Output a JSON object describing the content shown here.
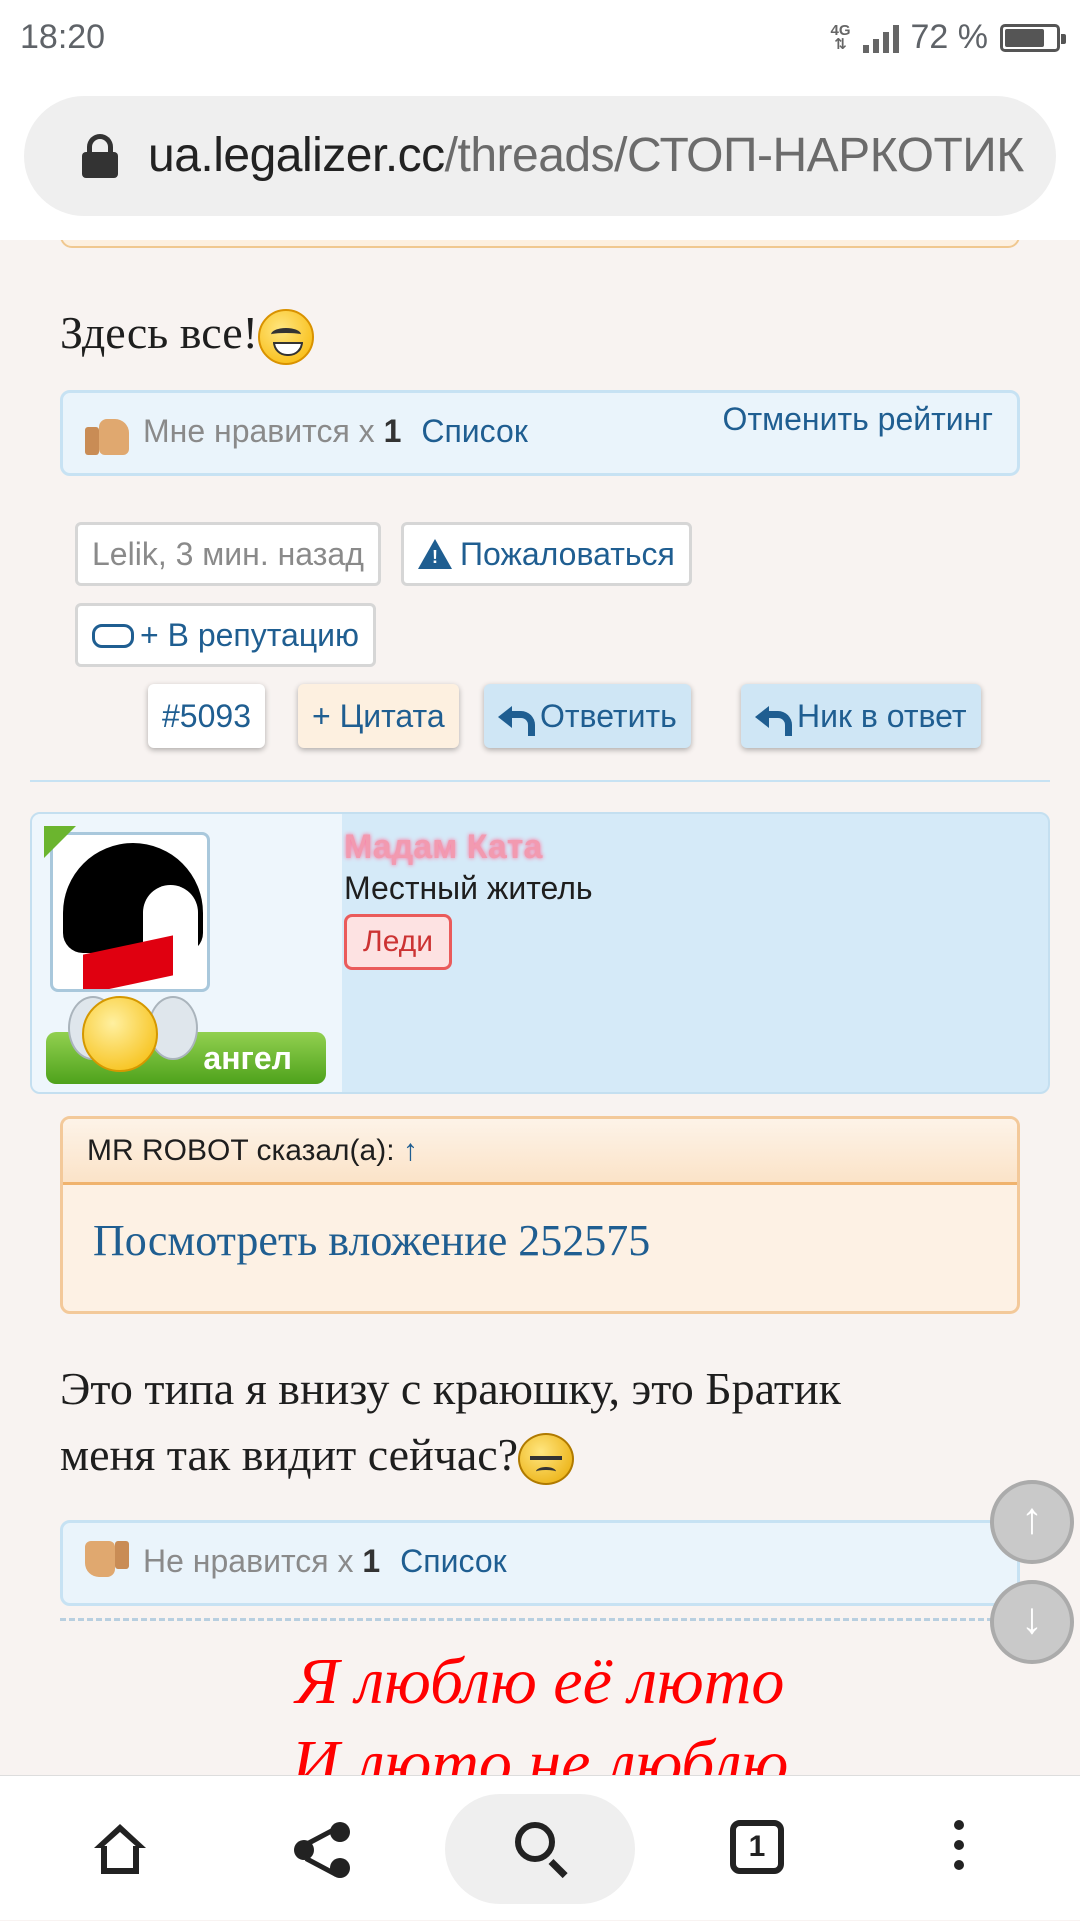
{
  "status_bar": {
    "time": "18:20",
    "network": "4G",
    "battery": "72 %",
    "battery_level": 0.72
  },
  "browser": {
    "url_domain": "ua.legalizer.cc",
    "url_path": "/threads/СТОП-НАРКОТИК"
  },
  "post1": {
    "text": "Здесь все!",
    "likes": {
      "label": "Мне нравится x",
      "count": "1",
      "list_link": "Список",
      "unrate_link": "Отменить рейтинг"
    },
    "meta": {
      "author_time": "Lelik, 3 мин. назад",
      "report": "Пожаловаться",
      "reputation": "+ В репутацию"
    },
    "actions": {
      "number": "#5093",
      "quote": "+ Цитата",
      "reply": "Ответить",
      "nick_reply": "Ник в ответ"
    }
  },
  "post2": {
    "user": {
      "name": "Мадам Ката",
      "title": "Местный житель",
      "badge": "Леди",
      "rank": "ангел"
    },
    "quote": {
      "author": "MR ROBOT сказал(а):",
      "arrow": "↑",
      "attachment": "Посмотреть вложение 252575"
    },
    "text_line1": "Это типа я внизу с краюшку, это Братик",
    "text_line2": "меня так видит сейчас?",
    "dislikes": {
      "label": "Не нравится x",
      "count": "1",
      "list_link": "Список"
    },
    "signature_line1": "Я люблю её люто",
    "signature_line2": "И люто не люблю"
  },
  "scroll": {
    "up": "↑",
    "down": "↓"
  },
  "bottom_nav": {
    "tabs_count": "1"
  }
}
